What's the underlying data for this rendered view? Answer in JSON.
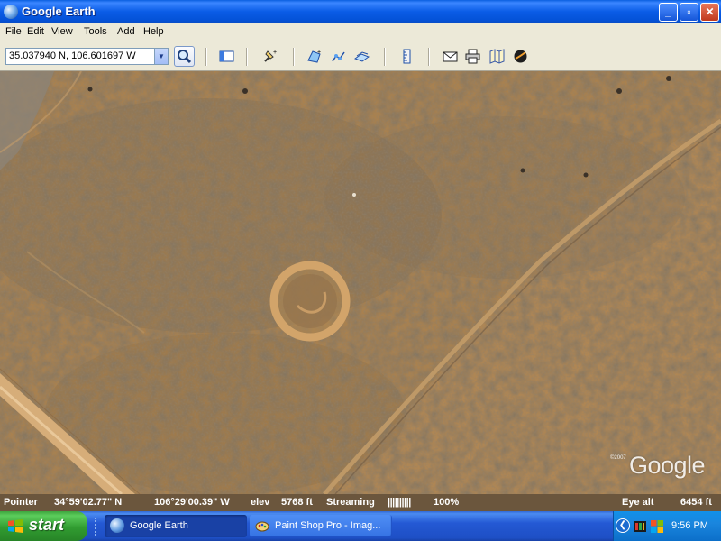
{
  "window": {
    "title": "Google Earth",
    "controls": {
      "minimize": "_",
      "maximize": "▫",
      "close": "✕"
    }
  },
  "menu": {
    "items": [
      "File",
      "Edit",
      "View",
      "Tools",
      "Add",
      "Help"
    ]
  },
  "toolbar": {
    "search_value": "35.037940 N, 106.601697 W",
    "icons": [
      "search-icon",
      "sidebar-icon",
      "placemark-icon",
      "polygon-icon",
      "path-icon",
      "image-overlay-icon",
      "ruler-icon",
      "email-icon",
      "print-icon",
      "google-maps-icon",
      "sky-icon"
    ]
  },
  "map": {
    "watermark_year": "©2007",
    "watermark": "Google"
  },
  "status": {
    "pointer_label": "Pointer",
    "pointer_lat": "34°59'02.77\" N",
    "pointer_lon": "106°29'00.39\" W",
    "elev_label": "elev",
    "elev_value": "5768 ft",
    "streaming_label": "Streaming",
    "streaming_bars": "||||||||||",
    "streaming_percent": "100%",
    "eye_alt_label": "Eye alt",
    "eye_alt_value": "6454 ft"
  },
  "taskbar": {
    "start_label": "start",
    "tasks": [
      {
        "label": "Google Earth",
        "icon": "google-earth-icon",
        "active": true
      },
      {
        "label": "Paint Shop Pro - Imag...",
        "icon": "paint-shop-pro-icon",
        "active": false
      }
    ],
    "clock": "9:56 PM"
  },
  "colors": {
    "titlebar": "#0a5ce6",
    "taskbar": "#2459d4",
    "start": "#319c31",
    "terrain": "#a17a4d",
    "status": "#6b563d"
  }
}
